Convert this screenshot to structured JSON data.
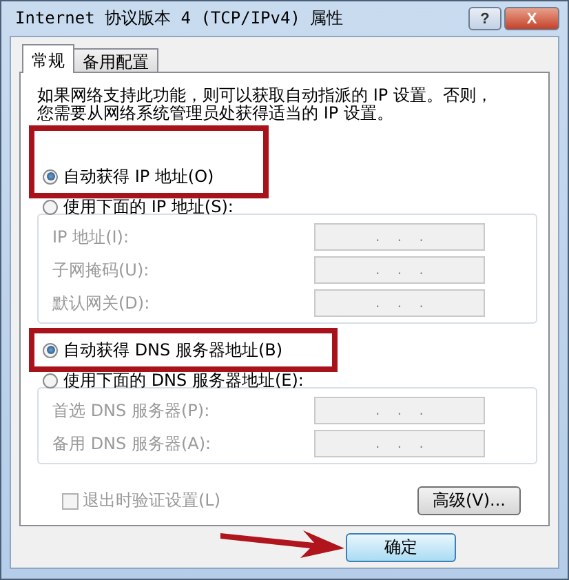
{
  "window": {
    "title": "Internet 协议版本 4 (TCP/IPv4) 属性",
    "help_button": "?",
    "close_button": "X"
  },
  "tabs": [
    {
      "label": "常规",
      "selected": true
    },
    {
      "label": "备用配置",
      "selected": false
    }
  ],
  "description": "如果网络支持此功能，则可以获取自动指派的 IP 设置。否则，您需要从网络系统管理员处获得适当的 IP 设置。",
  "sections": [
    {
      "auto": {
        "label": "自动获得 IP 地址(O)",
        "selected": true,
        "disabled": false,
        "highlighted": true
      },
      "manual": {
        "label": "使用下面的 IP 地址(S):",
        "selected": false,
        "disabled": false,
        "highlighted": false
      },
      "fields": [
        {
          "label": "IP 地址(I):",
          "value": ".    .    .",
          "disabled": true
        },
        {
          "label": "子网掩码(U):",
          "value": ".    .    .",
          "disabled": true
        },
        {
          "label": "默认网关(D):",
          "value": ".    .    .",
          "disabled": true
        }
      ]
    },
    {
      "auto": {
        "label": "自动获得 DNS 服务器地址(B)",
        "selected": true,
        "disabled": false,
        "highlighted": true
      },
      "manual": {
        "label": "使用下面的 DNS 服务器地址(E):",
        "selected": false,
        "disabled": false,
        "highlighted": false
      },
      "fields": [
        {
          "label": "首选 DNS 服务器(P):",
          "value": ".    .    .",
          "disabled": true
        },
        {
          "label": "备用 DNS 服务器(A):",
          "value": ".    .    .",
          "disabled": true
        }
      ]
    }
  ],
  "validate_checkbox": {
    "label": "退出时验证设置(L)",
    "checked": false,
    "disabled": true
  },
  "advanced_button": "高级(V)...",
  "ok_button": {
    "label": "确定",
    "highlighted": true
  }
}
